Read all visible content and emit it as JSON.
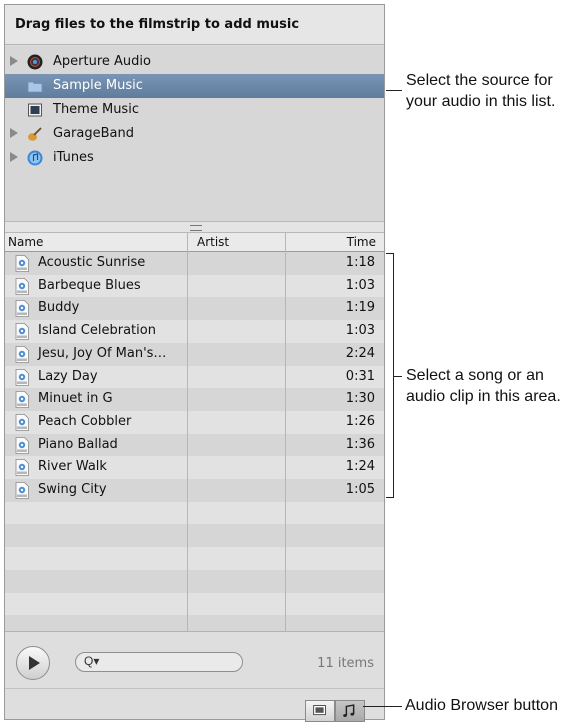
{
  "header": {
    "title": "Drag files to the filmstrip to add music"
  },
  "sources": [
    {
      "label": "Aperture Audio",
      "icon": "aperture-icon",
      "expandable": true,
      "selected": false
    },
    {
      "label": "Sample Music",
      "icon": "folder-icon",
      "expandable": false,
      "selected": true
    },
    {
      "label": "Theme Music",
      "icon": "theme-music-icon",
      "expandable": false,
      "selected": false
    },
    {
      "label": "GarageBand",
      "icon": "guitar-icon",
      "expandable": true,
      "selected": false
    },
    {
      "label": "iTunes",
      "icon": "itunes-icon",
      "expandable": true,
      "selected": false
    }
  ],
  "table": {
    "columns": {
      "name": "Name",
      "artist": "Artist",
      "time": "Time"
    },
    "rows": [
      {
        "name": "Acoustic Sunrise",
        "artist": "",
        "time": "1:18"
      },
      {
        "name": "Barbeque Blues",
        "artist": "",
        "time": "1:03"
      },
      {
        "name": "Buddy",
        "artist": "",
        "time": "1:19"
      },
      {
        "name": "Island Celebration",
        "artist": "",
        "time": "1:03"
      },
      {
        "name": "Jesu, Joy Of Man's…",
        "artist": "",
        "time": "2:24"
      },
      {
        "name": "Lazy Day",
        "artist": "",
        "time": "0:31"
      },
      {
        "name": "Minuet in G",
        "artist": "",
        "time": "1:30"
      },
      {
        "name": "Peach Cobbler",
        "artist": "",
        "time": "1:26"
      },
      {
        "name": "Piano Ballad",
        "artist": "",
        "time": "1:36"
      },
      {
        "name": "River Walk",
        "artist": "",
        "time": "1:24"
      },
      {
        "name": "Swing City",
        "artist": "",
        "time": "1:05"
      }
    ]
  },
  "footer": {
    "item_count": "11 items",
    "search_glyph": "Q▾",
    "view_buttons": [
      "photo-browser-icon",
      "music-note-icon"
    ]
  },
  "callouts": {
    "source": "Select the source for your audio in this list.",
    "song": "Select a song or an audio clip in this area.",
    "browser": "Audio Browser button"
  },
  "colors": {
    "selection": "#6a87a8",
    "panel": "#dcdcdc"
  }
}
